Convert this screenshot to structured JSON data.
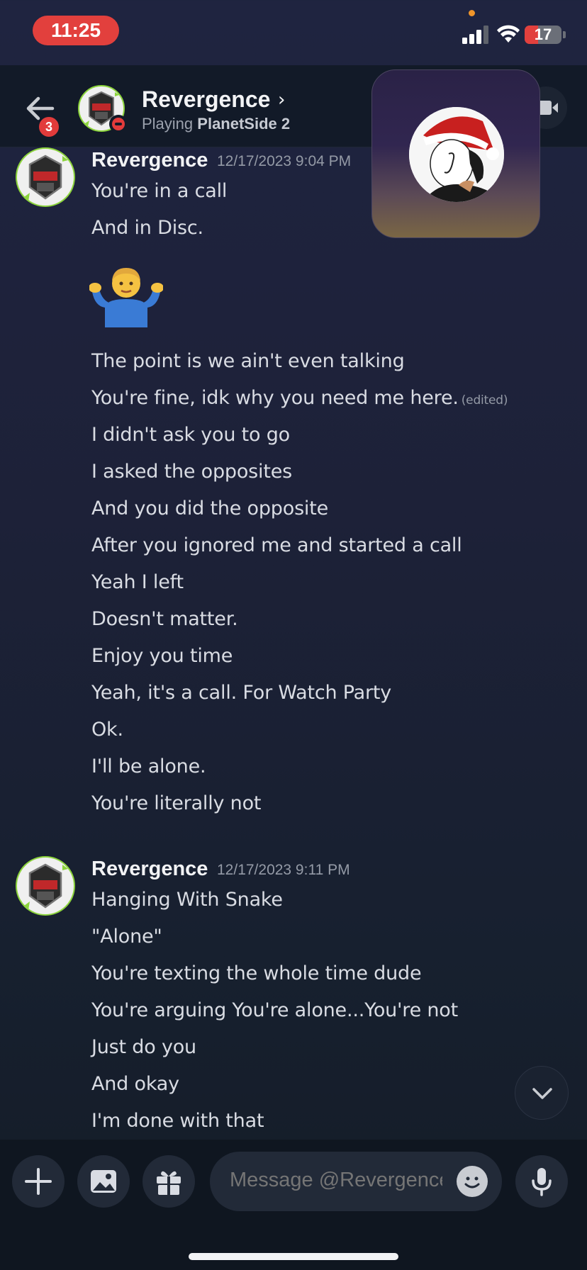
{
  "status_bar": {
    "time": "11:25",
    "battery_level": 17,
    "battery_label": "17"
  },
  "header": {
    "back_badge": "3",
    "user_name": "Revergence",
    "status_prefix": "Playing",
    "status_game": "PlanetSide 2"
  },
  "messages": [
    {
      "author": "Revergence",
      "timestamp": "12/17/2023 9:04 PM",
      "lines": [
        {
          "text": "You're in a call"
        },
        {
          "text": "And in Disc."
        },
        {
          "emoji": "person-shrugging"
        },
        {
          "text": "The point is we ain't even talking"
        },
        {
          "text": "You're fine, idk why you need me here.",
          "edited": "(edited)"
        },
        {
          "text": "I didn't ask you to go"
        },
        {
          "text": "I asked the opposites"
        },
        {
          "text": "And you did the opposite"
        },
        {
          "text": "After you ignored me and started a call"
        },
        {
          "text": "Yeah I left"
        },
        {
          "text": "Doesn't matter."
        },
        {
          "text": "Enjoy you time"
        },
        {
          "text": "Yeah, it's a call. For Watch Party"
        },
        {
          "text": "Ok."
        },
        {
          "text": "I'll be alone."
        },
        {
          "text": "You're literally not"
        }
      ]
    },
    {
      "author": "Revergence",
      "timestamp": "12/17/2023 9:11 PM",
      "lines": [
        {
          "text": "Hanging With Snake"
        },
        {
          "text": "\"Alone\""
        },
        {
          "text": "You're texting the whole time dude"
        },
        {
          "text": "You're arguing You're alone...You're not"
        },
        {
          "text": "Just do you"
        },
        {
          "text": "And okay"
        },
        {
          "text": "I'm done with that"
        }
      ]
    }
  ],
  "composer": {
    "placeholder": "Message @Revergence"
  },
  "icons": {
    "back": "arrow-left-icon",
    "video": "video-camera-icon",
    "add": "plus-icon",
    "image": "image-icon",
    "gift": "gift-icon",
    "emoji": "smiley-icon",
    "mic": "microphone-icon",
    "scroll": "chevron-down-icon"
  },
  "colors": {
    "status_red": "#e23b3b",
    "time_pill": "#e2403d",
    "text": "#d9dce3",
    "muted": "#949aa6"
  }
}
